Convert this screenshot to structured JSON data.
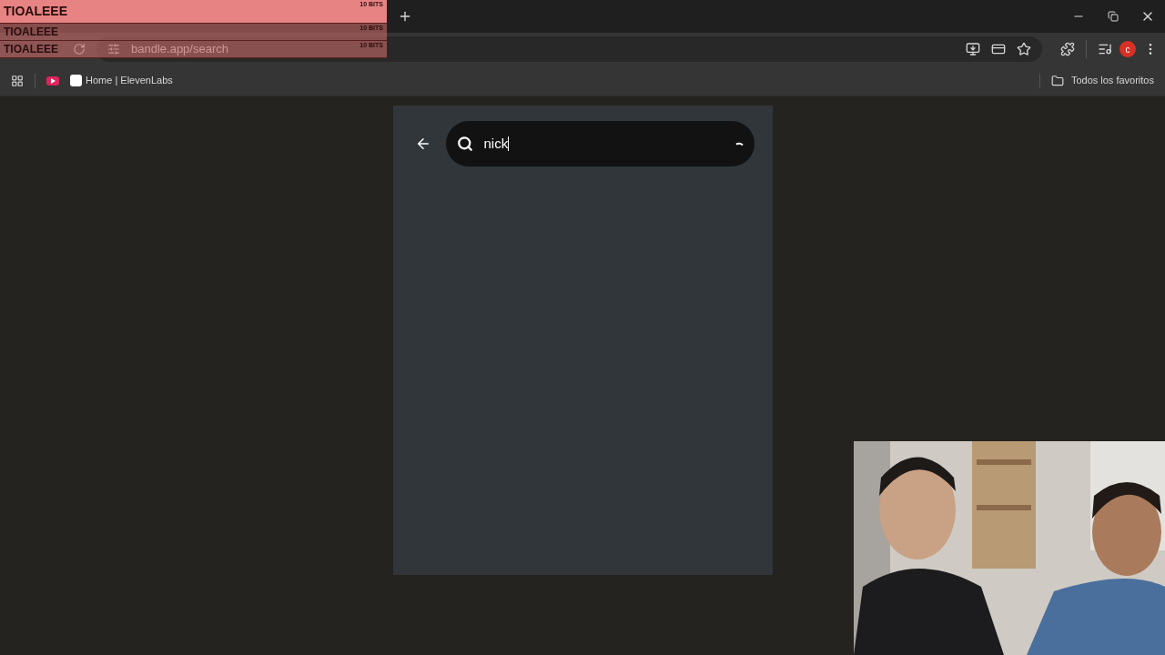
{
  "alerts": [
    {
      "name": "TIOALEEE",
      "bits": "10 BITS"
    },
    {
      "name": "TIOALEEE",
      "bits": "10 BITS"
    },
    {
      "name": "TIOALEEE",
      "bits": "10 BITS"
    }
  ],
  "address_bar": {
    "url": "bandle.app/search"
  },
  "bookmarks": [
    {
      "label": "Home | ElevenLabs"
    }
  ],
  "all_bookmarks": "Todos los favoritos",
  "profile": {
    "initial": "c"
  },
  "search": {
    "value": "nick",
    "loading": true
  }
}
